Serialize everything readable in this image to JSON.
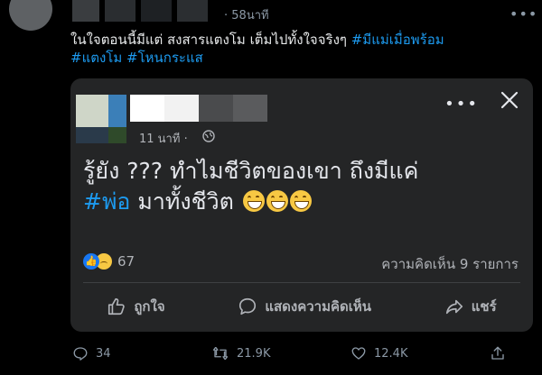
{
  "tweet": {
    "timestamp": "58นาที",
    "separator": "·",
    "text_line1": "ในใจตอนนี้มีแต่ สงสารแตงโม เต็มไปทั้งใจจริงๆ",
    "hashtag1": "#มีแม่เมื่อพร้อม",
    "hashtag2": "#แตงโม",
    "hashtag3": "#โหนกระแส",
    "more_icon": "more-horizontal-icon"
  },
  "fb_card": {
    "time": "11 นาที ·",
    "post_text_line1": "รู้ยัง ??? ทำไมชีวิตของเขา ถึงมีแค่",
    "post_hashtag": "#พ่อ",
    "post_text_line2": " มาทั้งชีวิต ",
    "reaction_count": "67",
    "comment_count": "ความคิดเห็น 9 รายการ",
    "actions": {
      "like": "ถูกใจ",
      "comment": "แสดงความคิดเห็น",
      "share": "แชร์"
    },
    "colors": {
      "bg": "#242526",
      "like_blue": "#1877f2",
      "emoji_yellow": "#f7c843"
    }
  },
  "tweet_actions": {
    "replies": "34",
    "retweets": "21.9K",
    "likes": "12.4K"
  },
  "colors": {
    "accent": "#1d9bf0",
    "muted": "#8b98a5",
    "bg": "#000000"
  }
}
